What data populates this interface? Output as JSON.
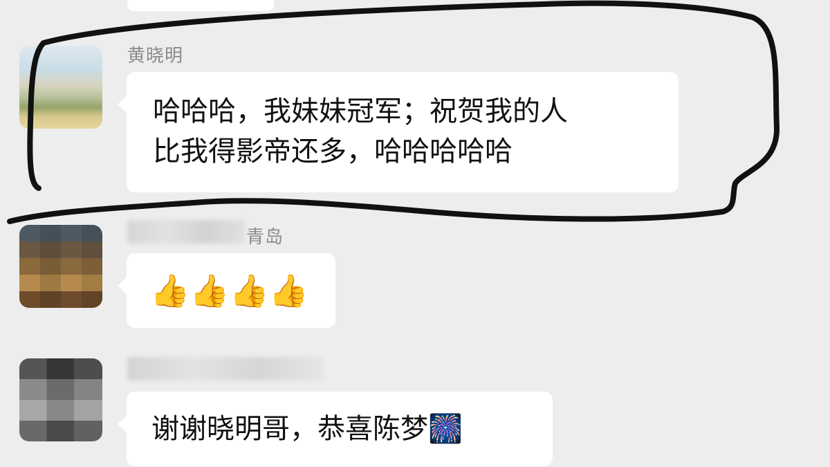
{
  "messages": [
    {
      "sender": "黄晓明",
      "text_lines": [
        "哈哈哈，我妹妹冠军；祝贺我的人",
        "比我得影帝还多，哈哈哈哈哈"
      ]
    },
    {
      "sender": "青岛",
      "text": "👍👍👍👍"
    },
    {
      "sender": "",
      "text": "谢谢晓明哥，恭喜陈梦🎆"
    }
  ],
  "colors": {
    "chat_background": "#ededed",
    "bubble_background": "#ffffff",
    "sender_text": "#8a8a8a",
    "marker": "#111111"
  },
  "icons": {
    "thumbs_up": "thumbs-up-emoji",
    "fireworks": "fireworks-emoji"
  }
}
